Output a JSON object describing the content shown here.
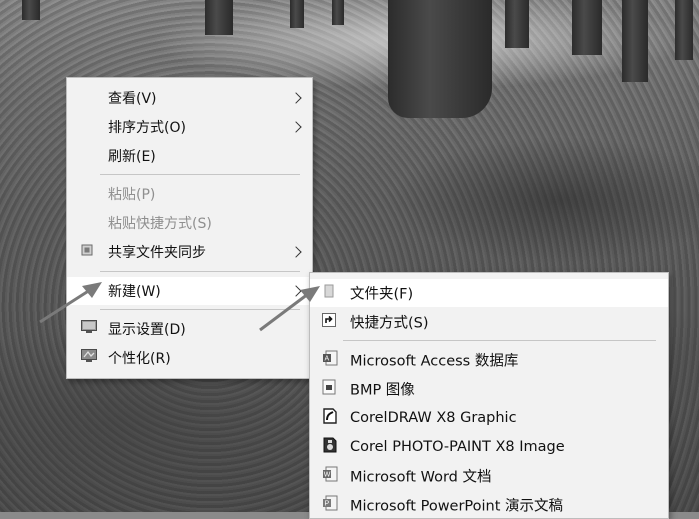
{
  "context_menu": {
    "items": [
      {
        "label": "查看(V)"
      },
      {
        "label": "排序方式(O)"
      },
      {
        "label": "刷新(E)"
      },
      {
        "label": "粘贴(P)"
      },
      {
        "label": "粘贴快捷方式(S)"
      },
      {
        "label": "共享文件夹同步"
      },
      {
        "label": "新建(W)"
      },
      {
        "label": "显示设置(D)"
      },
      {
        "label": "个性化(R)"
      }
    ]
  },
  "new_submenu": {
    "items": [
      {
        "label": "文件夹(F)",
        "icon": "folder-icon"
      },
      {
        "label": "快捷方式(S)",
        "icon": "shortcut-icon"
      },
      {
        "label": "Microsoft Access 数据库",
        "icon": "access-database-icon"
      },
      {
        "label": "BMP 图像",
        "icon": "bmp-image-icon"
      },
      {
        "label": "CorelDRAW X8 Graphic",
        "icon": "coreldraw-icon"
      },
      {
        "label": "Corel PHOTO-PAINT X8 Image",
        "icon": "corel-photo-paint-icon"
      },
      {
        "label": "Microsoft Word 文档",
        "icon": "word-document-icon"
      },
      {
        "label": "Microsoft PowerPoint 演示文稿",
        "icon": "powerpoint-icon"
      }
    ]
  }
}
